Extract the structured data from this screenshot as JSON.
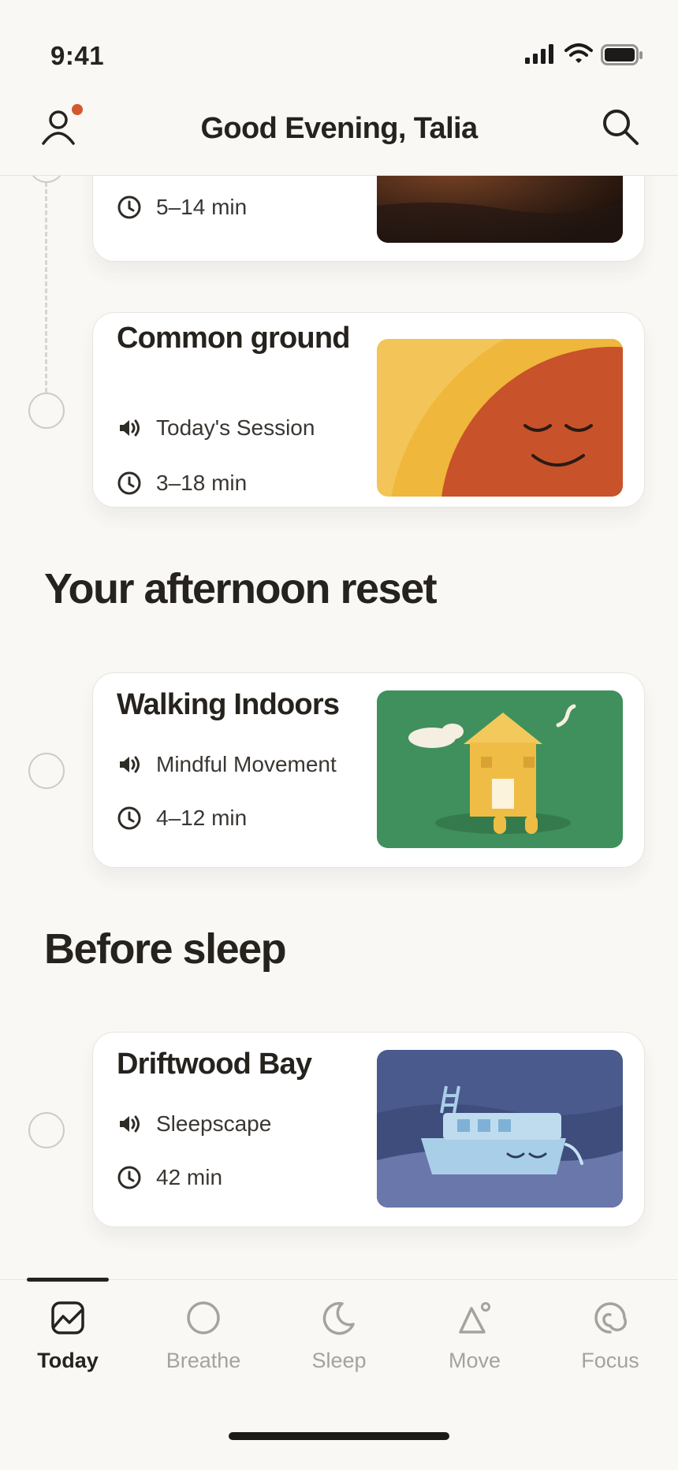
{
  "status_bar": {
    "time": "9:41"
  },
  "header": {
    "title": "Good Evening, Talia"
  },
  "timeline": {
    "partial_card": {
      "duration": "5–14 min"
    },
    "common_ground": {
      "title": "Common ground",
      "session": "Today's Session",
      "duration": "3–18 min"
    }
  },
  "sections": [
    {
      "title": "Your afternoon reset",
      "card": {
        "title": "Walking Indoors",
        "session": "Mindful Movement",
        "duration": "4–12 min"
      }
    },
    {
      "title": "Before sleep",
      "card": {
        "title": "Driftwood Bay",
        "session": "Sleepscape",
        "duration": "42 min"
      }
    }
  ],
  "tabbar": {
    "tabs": [
      {
        "label": "Today",
        "icon": "today-icon",
        "active": true
      },
      {
        "label": "Breathe",
        "icon": "breathe-icon"
      },
      {
        "label": "Sleep",
        "icon": "moon-icon"
      },
      {
        "label": "Move",
        "icon": "move-icon"
      },
      {
        "label": "Focus",
        "icon": "focus-icon"
      }
    ]
  },
  "colors": {
    "accent": "#d4582e",
    "background": "#f9f8f5"
  }
}
